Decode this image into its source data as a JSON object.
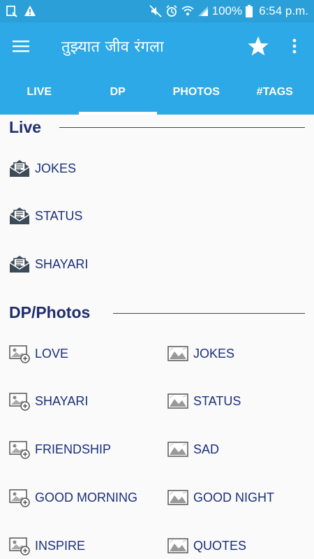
{
  "status_bar": {
    "battery": "100%",
    "time": "6:54 p.m."
  },
  "app_bar": {
    "title": "तुझ्यात जीव रंगला"
  },
  "tabs": [
    {
      "label": "LIVE"
    },
    {
      "label": "DP"
    },
    {
      "label": "PHOTOS"
    },
    {
      "label": "#TAGS"
    }
  ],
  "live_section": {
    "title": "Live",
    "items": [
      {
        "label": "JOKES"
      },
      {
        "label": "STATUS"
      },
      {
        "label": "SHAYARI"
      }
    ]
  },
  "dp_section": {
    "title": "DP/Photos",
    "left_items": [
      {
        "label": "LOVE"
      },
      {
        "label": "SHAYARI"
      },
      {
        "label": "FRIENDSHIP"
      },
      {
        "label": "GOOD MORNING"
      },
      {
        "label": "INSPIRE"
      }
    ],
    "right_items": [
      {
        "label": "JOKES"
      },
      {
        "label": "STATUS"
      },
      {
        "label": "SAD"
      },
      {
        "label": "GOOD NIGHT"
      },
      {
        "label": "QUOTES"
      }
    ]
  },
  "colors": {
    "primary": "#2ca9e6",
    "status_bar": "#2a9fd8",
    "heading_text": "#1f2d6e",
    "item_text": "#1a2f7a"
  },
  "icons": {
    "live_item": "open-envelope-icon",
    "dp_left_item": "add-photo-icon",
    "dp_right_item": "landscape-image-icon"
  }
}
